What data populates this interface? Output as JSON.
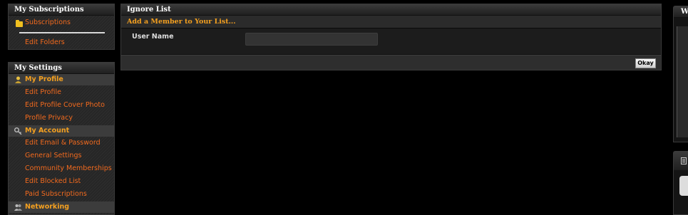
{
  "subscriptions_panel": {
    "title": "My Subscriptions",
    "links": [
      "Subscriptions",
      "Edit Folders"
    ]
  },
  "settings_panel": {
    "title": "My Settings",
    "sections": [
      {
        "label": "My Profile",
        "icon": "person-icon",
        "links": [
          "Edit Profile",
          "Edit Profile Cover Photo",
          "Profile Privacy"
        ]
      },
      {
        "label": "My Account",
        "icon": "key-icon",
        "links": [
          "Edit Email & Password",
          "General Settings",
          "Community Memberships",
          "Edit Blocked List",
          "Paid Subscriptions"
        ]
      },
      {
        "label": "Networking",
        "icon": "people-icon",
        "links": []
      }
    ]
  },
  "ignore_list": {
    "title": "Ignore List",
    "form_header": "Add a Member to Your List...",
    "user_name_label": "User Name",
    "user_name_value": "",
    "okay_label": "Okay"
  },
  "right_panel": {
    "title_fragment": "W"
  },
  "colors": {
    "link": "#f26a1e",
    "section_label": "#f4a020",
    "form_header": "#f4a020",
    "background": "#000000"
  }
}
